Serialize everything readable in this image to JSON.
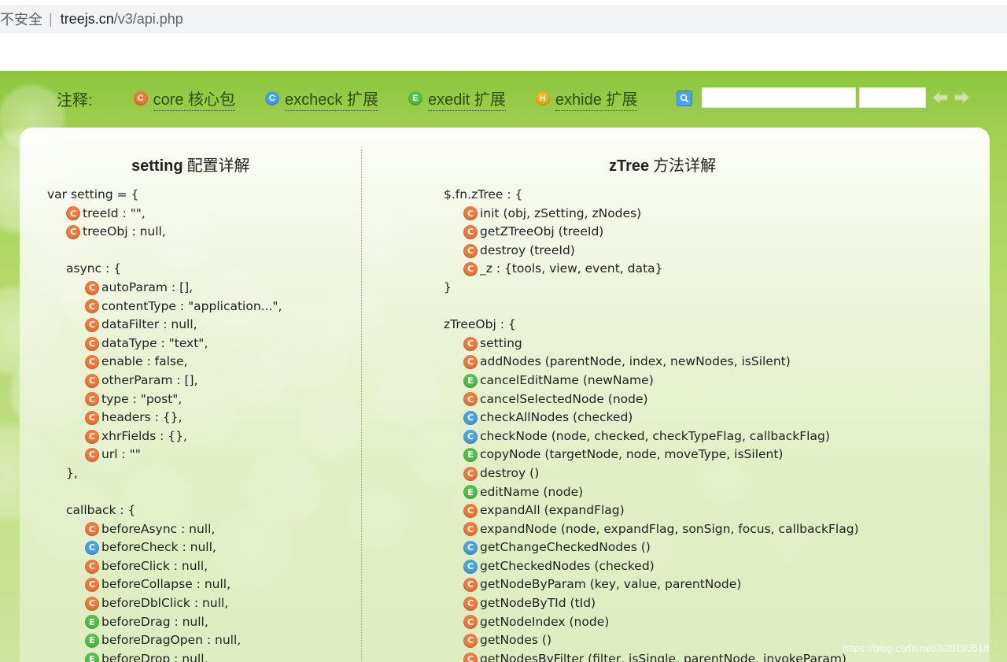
{
  "address_bar": {
    "security": "不安全",
    "separator": "|",
    "domain": "treejs.cn",
    "path": "/v3/api.php"
  },
  "legend": {
    "label": "注释:",
    "items": [
      {
        "badge": "C",
        "text": "core 核心包",
        "color": "#f07a3c"
      },
      {
        "badge": "C",
        "text": "excheck 扩展",
        "color": "#4aa3e3"
      },
      {
        "badge": "E",
        "text": "exedit 扩展",
        "color": "#52c04b"
      },
      {
        "badge": "H",
        "text": "exhide 扩展",
        "color": "#f0b01c"
      }
    ]
  },
  "search": {
    "value": "",
    "value2": ""
  },
  "left_title": {
    "bold": "setting",
    "rest": " 配置详解"
  },
  "right_title": {
    "bold": "zTree",
    "rest": " 方法详解"
  },
  "left_lines": [
    {
      "indent": 0,
      "text": "var setting = {"
    },
    {
      "indent": 1,
      "icon": "core",
      "text": "treeId : \"\","
    },
    {
      "indent": 1,
      "icon": "core",
      "text": "treeObj : null,"
    },
    {
      "indent": 0,
      "text": ""
    },
    {
      "indent": 1,
      "text": "async : {"
    },
    {
      "indent": 2,
      "icon": "core",
      "text": "autoParam : [],"
    },
    {
      "indent": 2,
      "icon": "core",
      "text": "contentType : \"application...\","
    },
    {
      "indent": 2,
      "icon": "core",
      "text": "dataFilter : null,"
    },
    {
      "indent": 2,
      "icon": "core",
      "text": "dataType : \"text\","
    },
    {
      "indent": 2,
      "icon": "core",
      "text": "enable : false,"
    },
    {
      "indent": 2,
      "icon": "core",
      "text": "otherParam : [],"
    },
    {
      "indent": 2,
      "icon": "core",
      "text": "type : \"post\","
    },
    {
      "indent": 2,
      "icon": "core",
      "text": "headers : {},"
    },
    {
      "indent": 2,
      "icon": "core",
      "text": "xhrFields : {},"
    },
    {
      "indent": 2,
      "icon": "core",
      "text": "url : \"\""
    },
    {
      "indent": 1,
      "text": "},"
    },
    {
      "indent": 0,
      "text": ""
    },
    {
      "indent": 1,
      "text": "callback : {"
    },
    {
      "indent": 2,
      "icon": "core",
      "text": "beforeAsync : null,"
    },
    {
      "indent": 2,
      "icon": "excheck",
      "text": "beforeCheck : null,"
    },
    {
      "indent": 2,
      "icon": "core",
      "text": "beforeClick : null,"
    },
    {
      "indent": 2,
      "icon": "core",
      "text": "beforeCollapse : null,"
    },
    {
      "indent": 2,
      "icon": "core",
      "text": "beforeDblClick : null,"
    },
    {
      "indent": 2,
      "icon": "exedit",
      "text": "beforeDrag : null,"
    },
    {
      "indent": 2,
      "icon": "exedit",
      "text": "beforeDragOpen : null,"
    },
    {
      "indent": 2,
      "icon": "exedit",
      "text": "beforeDrop : null,"
    }
  ],
  "right_lines": [
    {
      "indent": 0,
      "text": "$.fn.zTree : {"
    },
    {
      "indent": 1,
      "icon": "core",
      "text": "init (obj, zSetting, zNodes)"
    },
    {
      "indent": 1,
      "icon": "core",
      "text": "getZTreeObj (treeId)"
    },
    {
      "indent": 1,
      "icon": "core",
      "text": "destroy (treeId)"
    },
    {
      "indent": 1,
      "icon": "core",
      "text": "_z : {tools, view, event, data}"
    },
    {
      "indent": 0,
      "text": "}"
    },
    {
      "indent": 0,
      "text": ""
    },
    {
      "indent": 0,
      "text": "zTreeObj : {"
    },
    {
      "indent": 1,
      "icon": "core",
      "text": "setting"
    },
    {
      "indent": 1,
      "icon": "core",
      "text": "addNodes (parentNode, index, newNodes, isSilent)"
    },
    {
      "indent": 1,
      "icon": "exedit",
      "text": "cancelEditName (newName)"
    },
    {
      "indent": 1,
      "icon": "core",
      "text": "cancelSelectedNode (node)"
    },
    {
      "indent": 1,
      "icon": "excheck",
      "text": "checkAllNodes (checked)"
    },
    {
      "indent": 1,
      "icon": "excheck",
      "text": "checkNode (node, checked, checkTypeFlag, callbackFlag)"
    },
    {
      "indent": 1,
      "icon": "exedit",
      "text": "copyNode (targetNode, node, moveType, isSilent)"
    },
    {
      "indent": 1,
      "icon": "core",
      "text": "destroy ()"
    },
    {
      "indent": 1,
      "icon": "exedit",
      "text": "editName (node)"
    },
    {
      "indent": 1,
      "icon": "core",
      "text": "expandAll (expandFlag)"
    },
    {
      "indent": 1,
      "icon": "core",
      "text": "expandNode (node, expandFlag, sonSign, focus, callbackFlag)"
    },
    {
      "indent": 1,
      "icon": "excheck",
      "text": "getChangeCheckedNodes ()"
    },
    {
      "indent": 1,
      "icon": "excheck",
      "text": "getCheckedNodes (checked)"
    },
    {
      "indent": 1,
      "icon": "core",
      "text": "getNodeByParam (key, value, parentNode)"
    },
    {
      "indent": 1,
      "icon": "core",
      "text": "getNodeByTId (tId)"
    },
    {
      "indent": 1,
      "icon": "core",
      "text": "getNodeIndex (node)"
    },
    {
      "indent": 1,
      "icon": "core",
      "text": "getNodes ()"
    },
    {
      "indent": 1,
      "icon": "core",
      "text": "getNodesByFilter (filter, isSingle, parentNode, invokeParam)"
    }
  ],
  "watermark": "https://blog.csdn.net/A20190518"
}
